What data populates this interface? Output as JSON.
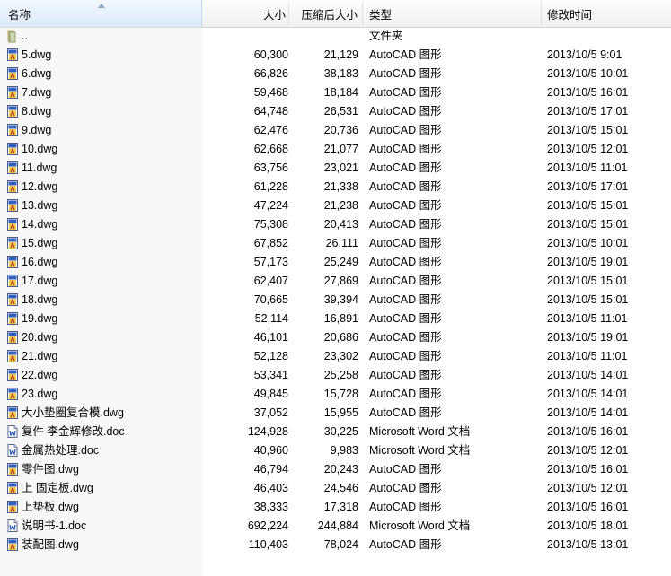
{
  "columns": {
    "name": "名称",
    "size": "大小",
    "compressed": "压缩后大小",
    "type": "类型",
    "modified": "修改时间"
  },
  "files": [
    {
      "name": "..",
      "size": "",
      "compressed": "",
      "type": "文件夹",
      "modified": "",
      "icon": "folder-icon"
    },
    {
      "name": "5.dwg",
      "size": "60,300",
      "compressed": "21,129",
      "type": "AutoCAD 图形",
      "modified": "2013/10/5 9:01",
      "icon": "dwg-file-icon"
    },
    {
      "name": "6.dwg",
      "size": "66,826",
      "compressed": "38,183",
      "type": "AutoCAD 图形",
      "modified": "2013/10/5 10:01",
      "icon": "dwg-file-icon"
    },
    {
      "name": "7.dwg",
      "size": "59,468",
      "compressed": "18,184",
      "type": "AutoCAD 图形",
      "modified": "2013/10/5 16:01",
      "icon": "dwg-file-icon"
    },
    {
      "name": "8.dwg",
      "size": "64,748",
      "compressed": "26,531",
      "type": "AutoCAD 图形",
      "modified": "2013/10/5 17:01",
      "icon": "dwg-file-icon"
    },
    {
      "name": "9.dwg",
      "size": "62,476",
      "compressed": "20,736",
      "type": "AutoCAD 图形",
      "modified": "2013/10/5 15:01",
      "icon": "dwg-file-icon"
    },
    {
      "name": "10.dwg",
      "size": "62,668",
      "compressed": "21,077",
      "type": "AutoCAD 图形",
      "modified": "2013/10/5 12:01",
      "icon": "dwg-file-icon"
    },
    {
      "name": "11.dwg",
      "size": "63,756",
      "compressed": "23,021",
      "type": "AutoCAD 图形",
      "modified": "2013/10/5 11:01",
      "icon": "dwg-file-icon"
    },
    {
      "name": "12.dwg",
      "size": "61,228",
      "compressed": "21,338",
      "type": "AutoCAD 图形",
      "modified": "2013/10/5 17:01",
      "icon": "dwg-file-icon"
    },
    {
      "name": "13.dwg",
      "size": "47,224",
      "compressed": "21,238",
      "type": "AutoCAD 图形",
      "modified": "2013/10/5 15:01",
      "icon": "dwg-file-icon"
    },
    {
      "name": "14.dwg",
      "size": "75,308",
      "compressed": "20,413",
      "type": "AutoCAD 图形",
      "modified": "2013/10/5 15:01",
      "icon": "dwg-file-icon"
    },
    {
      "name": "15.dwg",
      "size": "67,852",
      "compressed": "26,111",
      "type": "AutoCAD 图形",
      "modified": "2013/10/5 10:01",
      "icon": "dwg-file-icon"
    },
    {
      "name": "16.dwg",
      "size": "57,173",
      "compressed": "25,249",
      "type": "AutoCAD 图形",
      "modified": "2013/10/5 19:01",
      "icon": "dwg-file-icon"
    },
    {
      "name": "17.dwg",
      "size": "62,407",
      "compressed": "27,869",
      "type": "AutoCAD 图形",
      "modified": "2013/10/5 15:01",
      "icon": "dwg-file-icon"
    },
    {
      "name": "18.dwg",
      "size": "70,665",
      "compressed": "39,394",
      "type": "AutoCAD 图形",
      "modified": "2013/10/5 15:01",
      "icon": "dwg-file-icon"
    },
    {
      "name": "19.dwg",
      "size": "52,114",
      "compressed": "16,891",
      "type": "AutoCAD 图形",
      "modified": "2013/10/5 11:01",
      "icon": "dwg-file-icon"
    },
    {
      "name": "20.dwg",
      "size": "46,101",
      "compressed": "20,686",
      "type": "AutoCAD 图形",
      "modified": "2013/10/5 19:01",
      "icon": "dwg-file-icon"
    },
    {
      "name": "21.dwg",
      "size": "52,128",
      "compressed": "23,302",
      "type": "AutoCAD 图形",
      "modified": "2013/10/5 11:01",
      "icon": "dwg-file-icon"
    },
    {
      "name": "22.dwg",
      "size": "53,341",
      "compressed": "25,258",
      "type": "AutoCAD 图形",
      "modified": "2013/10/5 14:01",
      "icon": "dwg-file-icon"
    },
    {
      "name": "23.dwg",
      "size": "49,845",
      "compressed": "15,728",
      "type": "AutoCAD 图形",
      "modified": "2013/10/5 14:01",
      "icon": "dwg-file-icon"
    },
    {
      "name": "大小垫圈复合模.dwg",
      "size": "37,052",
      "compressed": "15,955",
      "type": "AutoCAD 图形",
      "modified": "2013/10/5 14:01",
      "icon": "dwg-file-icon"
    },
    {
      "name": "复件 李金辉修改.doc",
      "size": "124,928",
      "compressed": "30,225",
      "type": "Microsoft Word 文档",
      "modified": "2013/10/5 16:01",
      "icon": "word-doc-icon"
    },
    {
      "name": "金属热处理.doc",
      "size": "40,960",
      "compressed": "9,983",
      "type": "Microsoft Word 文档",
      "modified": "2013/10/5 12:01",
      "icon": "word-doc-icon"
    },
    {
      "name": "零件图.dwg",
      "size": "46,794",
      "compressed": "20,243",
      "type": "AutoCAD 图形",
      "modified": "2013/10/5 16:01",
      "icon": "dwg-file-icon"
    },
    {
      "name": "上 固定板.dwg",
      "size": "46,403",
      "compressed": "24,546",
      "type": "AutoCAD 图形",
      "modified": "2013/10/5 12:01",
      "icon": "dwg-file-icon"
    },
    {
      "name": "上垫板.dwg",
      "size": "38,333",
      "compressed": "17,318",
      "type": "AutoCAD 图形",
      "modified": "2013/10/5 16:01",
      "icon": "dwg-file-icon"
    },
    {
      "name": "说明书-1.doc",
      "size": "692,224",
      "compressed": "244,884",
      "type": "Microsoft Word 文档",
      "modified": "2013/10/5 18:01",
      "icon": "word-doc-icon"
    },
    {
      "name": "装配图.dwg",
      "size": "110,403",
      "compressed": "78,024",
      "type": "AutoCAD 图形",
      "modified": "2013/10/5 13:01",
      "icon": "dwg-file-icon"
    }
  ]
}
